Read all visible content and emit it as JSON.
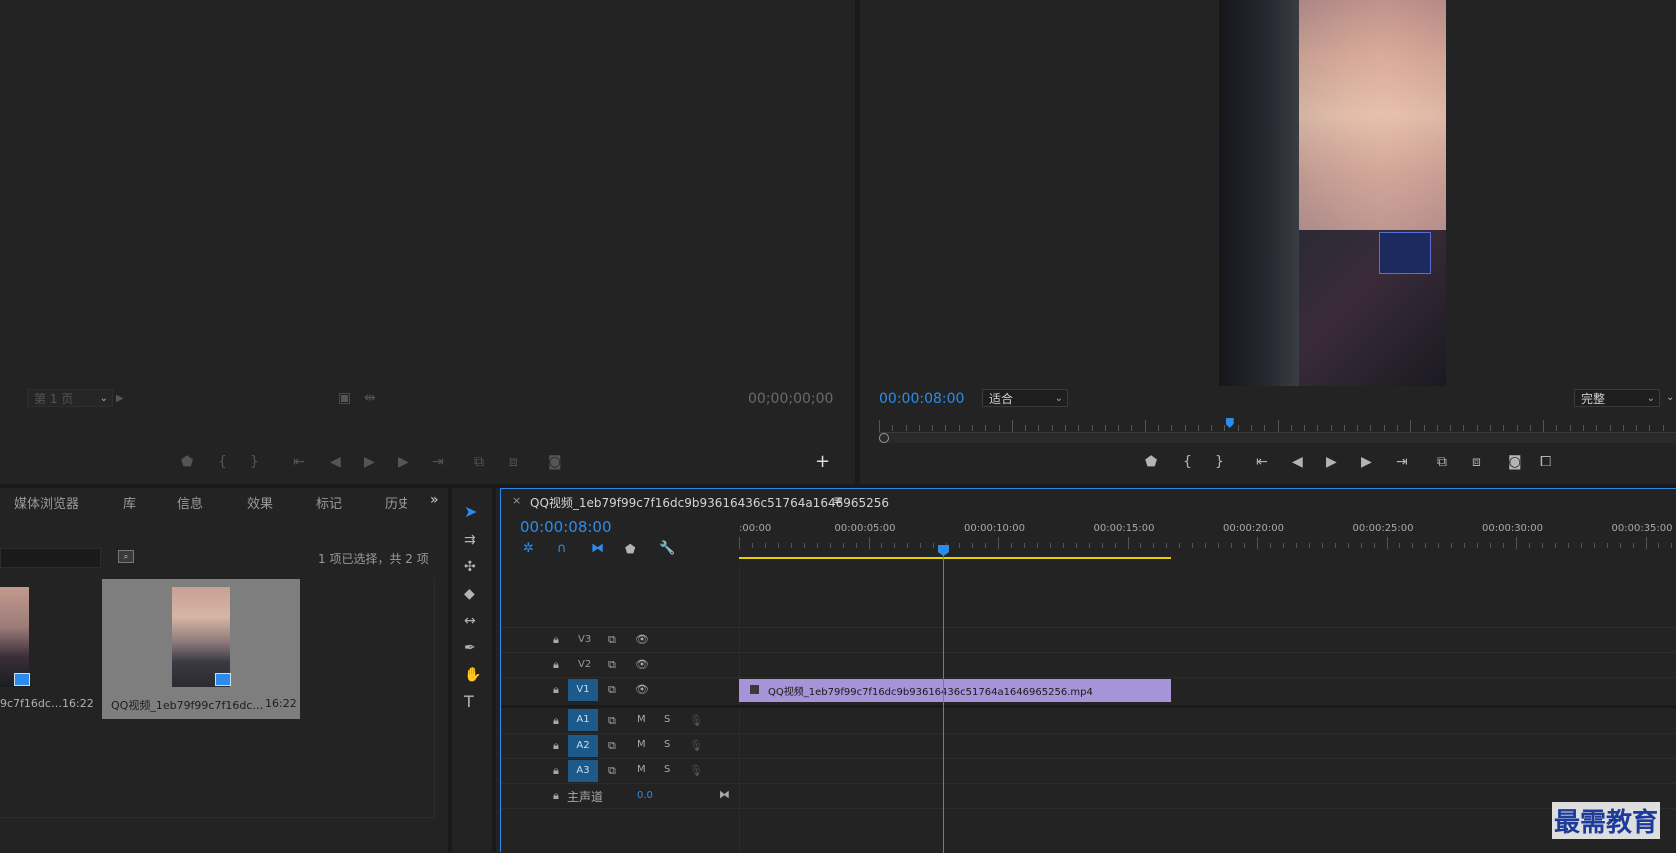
{
  "source_monitor": {
    "page_select": "第 1 页",
    "timecode": "00;00;00;00"
  },
  "program_monitor": {
    "timecode": "00:00:08:00",
    "zoom_select": "适合",
    "quality_select": "完整",
    "playhead_fraction": 0.44
  },
  "project_panel": {
    "tabs": [
      "媒体浏览器",
      "库",
      "信息",
      "效果",
      "标记",
      "历史"
    ],
    "selection_status": "1 项已选择，共 2 项",
    "items": [
      {
        "name": "9c7f16dc…",
        "duration": "16:22"
      },
      {
        "name": "QQ视频_1eb79f99c7f16dc…",
        "duration": "16:22"
      }
    ]
  },
  "timeline": {
    "sequence_name": "QQ视频_1eb79f99c7f16dc9b93616436c51764a1646965256",
    "timecode": "00:00:08:00",
    "ruler_labels": [
      ":00:00",
      "00:00:05:00",
      "00:00:10:00",
      "00:00:15:00",
      "00:00:20:00",
      "00:00:25:00",
      "00:00:30:00",
      "00:00:35:00"
    ],
    "tracks": {
      "video": [
        "V3",
        "V2",
        "V1"
      ],
      "audio": [
        "A1",
        "A2",
        "A3"
      ],
      "mute_label": "M",
      "solo_label": "S",
      "master": "主声道",
      "master_value": "0.0"
    },
    "clip_name": "QQ视频_1eb79f99c7f16dc9b93616436c51764a1646965256.mp4"
  },
  "watermark": "最需教育",
  "colors": {
    "accent": "#2d8ceb",
    "clip": "#a693d8",
    "work_area": "#e5d200",
    "track_badge": "#1b5a8a"
  }
}
